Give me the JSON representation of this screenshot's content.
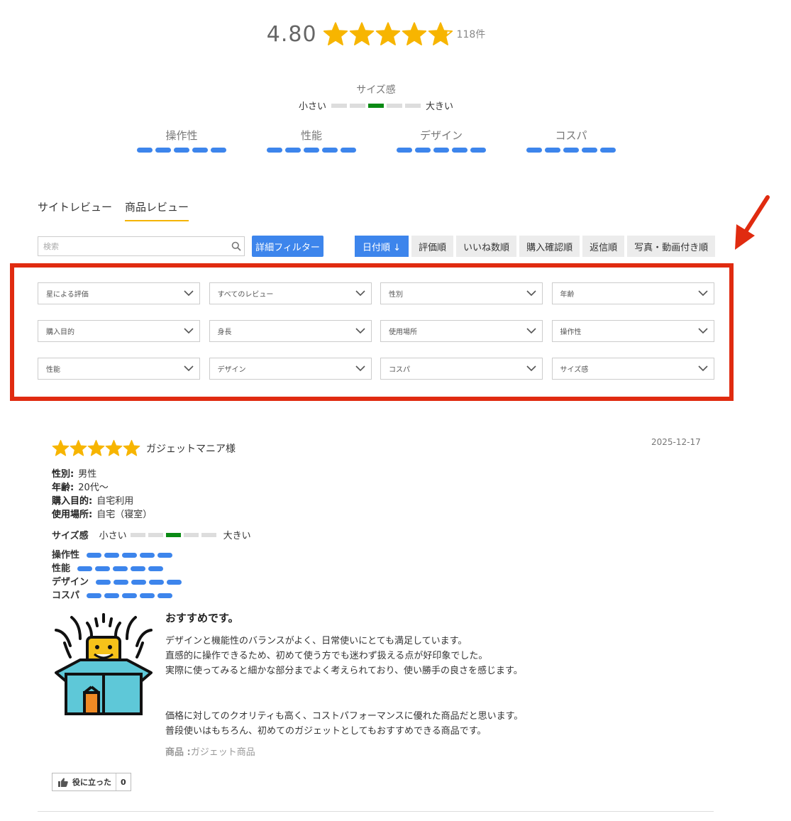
{
  "rating": {
    "score": "4.80",
    "count": "118件",
    "stars_value": 4.8
  },
  "size_scale": {
    "title": "サイズ感",
    "small": "小さい",
    "large": "大きい",
    "selected_index": 2,
    "segments": 5
  },
  "metrics": [
    {
      "label": "操作性",
      "level": 5
    },
    {
      "label": "性能",
      "level": 5
    },
    {
      "label": "デザイン",
      "level": 5
    },
    {
      "label": "コスパ",
      "level": 5
    }
  ],
  "tabs": [
    {
      "label": "サイトレビュー",
      "active": false
    },
    {
      "label": "商品レビュー",
      "active": true
    }
  ],
  "search": {
    "placeholder": "検索"
  },
  "filter_button": "詳細フィルター",
  "sort_buttons": [
    {
      "label": "日付順 ↓",
      "active": true
    },
    {
      "label": "評価順",
      "active": false
    },
    {
      "label": "いいね数順",
      "active": false
    },
    {
      "label": "購入確認順",
      "active": false
    },
    {
      "label": "返信順",
      "active": false
    },
    {
      "label": "写真・動画付き順",
      "active": false
    }
  ],
  "filters": [
    "星による評価",
    "すべてのレビュー",
    "性別",
    "年齢",
    "購入目的",
    "身長",
    "使用場所",
    "操作性",
    "性能",
    "デザイン",
    "コスパ",
    "サイズ感"
  ],
  "review": {
    "stars": 5,
    "reviewer": "ガジェットマニア様",
    "date": "2025-12-17",
    "attributes": [
      {
        "key": "性別:",
        "value": "男性"
      },
      {
        "key": "年齢:",
        "value": "20代〜"
      },
      {
        "key": "購入目的:",
        "value": "自宅利用"
      },
      {
        "key": "使用場所:",
        "value": "自宅（寝室）"
      }
    ],
    "size": {
      "label": "サイズ感",
      "small": "小さい",
      "large": "大きい",
      "selected_index": 2
    },
    "metrics": [
      {
        "label": "操作性",
        "level": 5
      },
      {
        "label": "性能",
        "level": 5
      },
      {
        "label": "デザイン",
        "level": 5
      },
      {
        "label": "コスパ",
        "level": 5
      }
    ],
    "title": "おすすめです。",
    "paragraph1": [
      "デザインと機能性のバランスがよく、日常使いにとても満足しています。",
      "直感的に操作できるため、初めて使う方でも迷わず扱える点が好印象でした。",
      "実際に使ってみると細かな部分までよく考えられており、使い勝手の良さを感じます。"
    ],
    "paragraph2": [
      "価格に対してのクオリティも高く、コストパフォーマンスに優れた商品だと思います。",
      "普段使いはもちろん、初めてのガジェットとしてもおすすめできる商品です。"
    ],
    "product_label": "商品 :",
    "product_name": "ガジェット商品",
    "helpful_label": "役に立った",
    "helpful_count": "0"
  },
  "colors": {
    "accent": "#3d85ec",
    "star": "#f7b500",
    "size_on": "#0a8a14",
    "highlight": "#e02b10",
    "tab_underline": "#f4b400"
  }
}
